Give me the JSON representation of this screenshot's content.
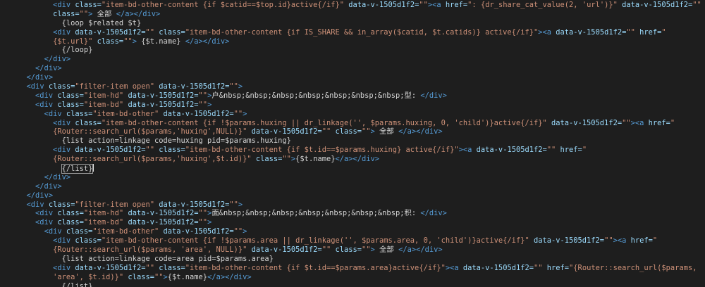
{
  "colors": {
    "background": "#1e1e1e",
    "tag": "#569cd6",
    "attr": "#9cdcfe",
    "string": "#ce9178",
    "text": "#d4d4d4"
  },
  "lines": [
    {
      "indent": 12,
      "tokens": [
        [
          "tag",
          "<div "
        ],
        [
          "attr",
          "class="
        ],
        [
          "str",
          "\"item-bd-other-content {if $catid==$top.id}active{/if}\""
        ],
        [
          "attr",
          " data-v-1505d1f2="
        ],
        [
          "str",
          "\"\""
        ],
        [
          "tag",
          "><a "
        ],
        [
          "attr",
          "href="
        ],
        [
          "str",
          "\": {dr_share_cat_value(2, 'url')}\""
        ],
        [
          "attr",
          " data-v-1505d1f2="
        ],
        [
          "str",
          "\"\""
        ]
      ]
    },
    {
      "indent": 12,
      "tokens": [
        [
          "attr",
          "class="
        ],
        [
          "str",
          "\"\""
        ],
        [
          "tag",
          "> "
        ],
        [
          "txt",
          "全部 "
        ],
        [
          "tag",
          "</a></div>"
        ]
      ]
    },
    {
      "indent": 14,
      "tokens": [
        [
          "txt",
          "{loop $related $t}"
        ]
      ]
    },
    {
      "indent": 12,
      "tokens": [
        [
          "tag",
          "<div "
        ],
        [
          "attr",
          "data-v-1505d1f2="
        ],
        [
          "str",
          "\"\""
        ],
        [
          "attr",
          " class="
        ],
        [
          "str",
          "\"item-bd-other-content {if IS_SHARE && in_array($catid, $t.catids)} active{/if}\""
        ],
        [
          "tag",
          "><a "
        ],
        [
          "attr",
          "data-v-1505d1f2="
        ],
        [
          "str",
          "\"\""
        ],
        [
          "attr",
          " href="
        ],
        [
          "str",
          "\""
        ]
      ]
    },
    {
      "indent": 12,
      "tokens": [
        [
          "str",
          "{$t.url}\""
        ],
        [
          "attr",
          " class="
        ],
        [
          "str",
          "\"\""
        ],
        [
          "tag",
          "> "
        ],
        [
          "txt",
          "{$t.name} "
        ],
        [
          "tag",
          "</a></div>"
        ]
      ]
    },
    {
      "indent": 14,
      "tokens": [
        [
          "txt",
          "{/loop}"
        ]
      ]
    },
    {
      "indent": 10,
      "tokens": [
        [
          "tag",
          "</div>"
        ]
      ]
    },
    {
      "indent": 8,
      "tokens": [
        [
          "tag",
          "</div>"
        ]
      ]
    },
    {
      "indent": 6,
      "tokens": [
        [
          "tag",
          "</div>"
        ]
      ]
    },
    {
      "indent": 6,
      "tokens": [
        [
          "tag",
          "<div "
        ],
        [
          "attr",
          "class="
        ],
        [
          "str",
          "\"filter-item open\""
        ],
        [
          "attr",
          " data-v-1505d1f2="
        ],
        [
          "str",
          "\"\""
        ],
        [
          "tag",
          ">"
        ]
      ]
    },
    {
      "indent": 8,
      "tokens": [
        [
          "tag",
          "<div "
        ],
        [
          "attr",
          "class="
        ],
        [
          "str",
          "\"item-hd\""
        ],
        [
          "attr",
          " data-v-1505d1f2="
        ],
        [
          "str",
          "\"\""
        ],
        [
          "tag",
          ">"
        ],
        [
          "txt",
          "户&nbsp;&nbsp;&nbsp;&nbsp;&nbsp;&nbsp;&nbsp;型: "
        ],
        [
          "tag",
          "</div>"
        ]
      ]
    },
    {
      "indent": 8,
      "tokens": [
        [
          "tag",
          "<div "
        ],
        [
          "attr",
          "class="
        ],
        [
          "str",
          "\"item-bd\""
        ],
        [
          "attr",
          " data-v-1505d1f2="
        ],
        [
          "str",
          "\"\""
        ],
        [
          "tag",
          ">"
        ]
      ]
    },
    {
      "indent": 10,
      "tokens": [
        [
          "tag",
          "<div "
        ],
        [
          "attr",
          "class="
        ],
        [
          "str",
          "\"item-bd-other\""
        ],
        [
          "attr",
          " data-v-1505d1f2="
        ],
        [
          "str",
          "\"\""
        ],
        [
          "tag",
          ">"
        ]
      ]
    },
    {
      "indent": 12,
      "tokens": [
        [
          "tag",
          "<div "
        ],
        [
          "attr",
          "class="
        ],
        [
          "str",
          "\"item-bd-other-content {if !$params.huxing || dr_linkage('', $params.huxing, 0, 'child')}active{/if}\""
        ],
        [
          "attr",
          " data-v-1505d1f2="
        ],
        [
          "str",
          "\"\""
        ],
        [
          "tag",
          "><a "
        ],
        [
          "attr",
          "href="
        ],
        [
          "str",
          "\""
        ]
      ]
    },
    {
      "indent": 12,
      "tokens": [
        [
          "str",
          "{Router::search_url($params,'huxing',NULL)}\""
        ],
        [
          "attr",
          " data-v-1505d1f2="
        ],
        [
          "str",
          "\"\""
        ],
        [
          "attr",
          " class="
        ],
        [
          "str",
          "\"\""
        ],
        [
          "tag",
          "> "
        ],
        [
          "txt",
          "全部 "
        ],
        [
          "tag",
          "</a></div>"
        ]
      ]
    },
    {
      "indent": 14,
      "tokens": [
        [
          "txt",
          "{list action=linkage code=huxing pid=$params.huxing}"
        ]
      ]
    },
    {
      "indent": 12,
      "tokens": [
        [
          "tag",
          "<div "
        ],
        [
          "attr",
          "data-v-1505d1f2="
        ],
        [
          "str",
          "\"\""
        ],
        [
          "attr",
          " class="
        ],
        [
          "str",
          "\"item-bd-other-content {if $t.id==$params.huxing} active{/if}\""
        ],
        [
          "tag",
          "><a "
        ],
        [
          "attr",
          "data-v-1505d1f2="
        ],
        [
          "str",
          "\"\""
        ],
        [
          "attr",
          " href="
        ],
        [
          "str",
          "\""
        ]
      ]
    },
    {
      "indent": 12,
      "tokens": [
        [
          "str",
          "{Router::search_url($params,'huxing',$t.id)}\""
        ],
        [
          "attr",
          " class="
        ],
        [
          "str",
          "\"\""
        ],
        [
          "tag",
          ">"
        ],
        [
          "txt",
          "{$t.name}"
        ],
        [
          "tag",
          "</a></div>"
        ]
      ]
    },
    {
      "indent": 14,
      "tokens": [
        [
          "txt",
          "{/list}"
        ]
      ],
      "cursor": true
    },
    {
      "indent": 10,
      "tokens": [
        [
          "tag",
          "</div>"
        ]
      ]
    },
    {
      "indent": 8,
      "tokens": [
        [
          "tag",
          "</div>"
        ]
      ]
    },
    {
      "indent": 6,
      "tokens": [
        [
          "tag",
          "</div>"
        ]
      ]
    },
    {
      "indent": 6,
      "tokens": [
        [
          "tag",
          "<div "
        ],
        [
          "attr",
          "class="
        ],
        [
          "str",
          "\"filter-item open\""
        ],
        [
          "attr",
          " data-v-1505d1f2="
        ],
        [
          "str",
          "\"\""
        ],
        [
          "tag",
          ">"
        ]
      ]
    },
    {
      "indent": 8,
      "tokens": [
        [
          "tag",
          "<div "
        ],
        [
          "attr",
          "class="
        ],
        [
          "str",
          "\"item-hd\""
        ],
        [
          "attr",
          " data-v-1505d1f2="
        ],
        [
          "str",
          "\"\""
        ],
        [
          "tag",
          ">"
        ],
        [
          "txt",
          "面&nbsp;&nbsp;&nbsp;&nbsp;&nbsp;&nbsp;&nbsp;积: "
        ],
        [
          "tag",
          "</div>"
        ]
      ]
    },
    {
      "indent": 8,
      "tokens": [
        [
          "tag",
          "<div "
        ],
        [
          "attr",
          "class="
        ],
        [
          "str",
          "\"item-bd\""
        ],
        [
          "attr",
          " data-v-1505d1f2="
        ],
        [
          "str",
          "\"\""
        ],
        [
          "tag",
          ">"
        ]
      ]
    },
    {
      "indent": 10,
      "tokens": [
        [
          "tag",
          "<div "
        ],
        [
          "attr",
          "class="
        ],
        [
          "str",
          "\"item-bd-other\""
        ],
        [
          "attr",
          " data-v-1505d1f2="
        ],
        [
          "str",
          "\"\""
        ],
        [
          "tag",
          ">"
        ]
      ]
    },
    {
      "indent": 12,
      "tokens": [
        [
          "tag",
          "<div "
        ],
        [
          "attr",
          "class="
        ],
        [
          "str",
          "\"item-bd-other-content {if !$params.area || dr_linkage('', $params.area, 0, 'child')}active{/if}\""
        ],
        [
          "attr",
          " data-v-1505d1f2="
        ],
        [
          "str",
          "\"\""
        ],
        [
          "tag",
          "><a "
        ],
        [
          "attr",
          "href="
        ],
        [
          "str",
          "\""
        ]
      ]
    },
    {
      "indent": 12,
      "tokens": [
        [
          "str",
          "{Router::search_url($params, 'area', NULL)}\""
        ],
        [
          "attr",
          " data-v-1505d1f2="
        ],
        [
          "str",
          "\"\""
        ],
        [
          "attr",
          " class="
        ],
        [
          "str",
          "\"\""
        ],
        [
          "tag",
          "> "
        ],
        [
          "txt",
          "全部 "
        ],
        [
          "tag",
          "</a></div>"
        ]
      ]
    },
    {
      "indent": 14,
      "tokens": [
        [
          "txt",
          "{list action=linkage code=area pid=$params.area}"
        ]
      ]
    },
    {
      "indent": 12,
      "tokens": [
        [
          "tag",
          "<div "
        ],
        [
          "attr",
          "data-v-1505d1f2="
        ],
        [
          "str",
          "\"\""
        ],
        [
          "attr",
          " class="
        ],
        [
          "str",
          "\"item-bd-other-content {if $t.id==$params.area}active{/if}\""
        ],
        [
          "tag",
          "><a "
        ],
        [
          "attr",
          "data-v-1505d1f2="
        ],
        [
          "str",
          "\"\""
        ],
        [
          "attr",
          " href="
        ],
        [
          "str",
          "\"{Router::search_url($params,"
        ]
      ]
    },
    {
      "indent": 12,
      "tokens": [
        [
          "str",
          "'area', $t.id)}\""
        ],
        [
          "attr",
          " class="
        ],
        [
          "str",
          "\"\""
        ],
        [
          "tag",
          ">"
        ],
        [
          "txt",
          "{$t.name}"
        ],
        [
          "tag",
          "</a></div>"
        ]
      ]
    },
    {
      "indent": 14,
      "tokens": [
        [
          "txt",
          "{/list}"
        ]
      ]
    }
  ]
}
